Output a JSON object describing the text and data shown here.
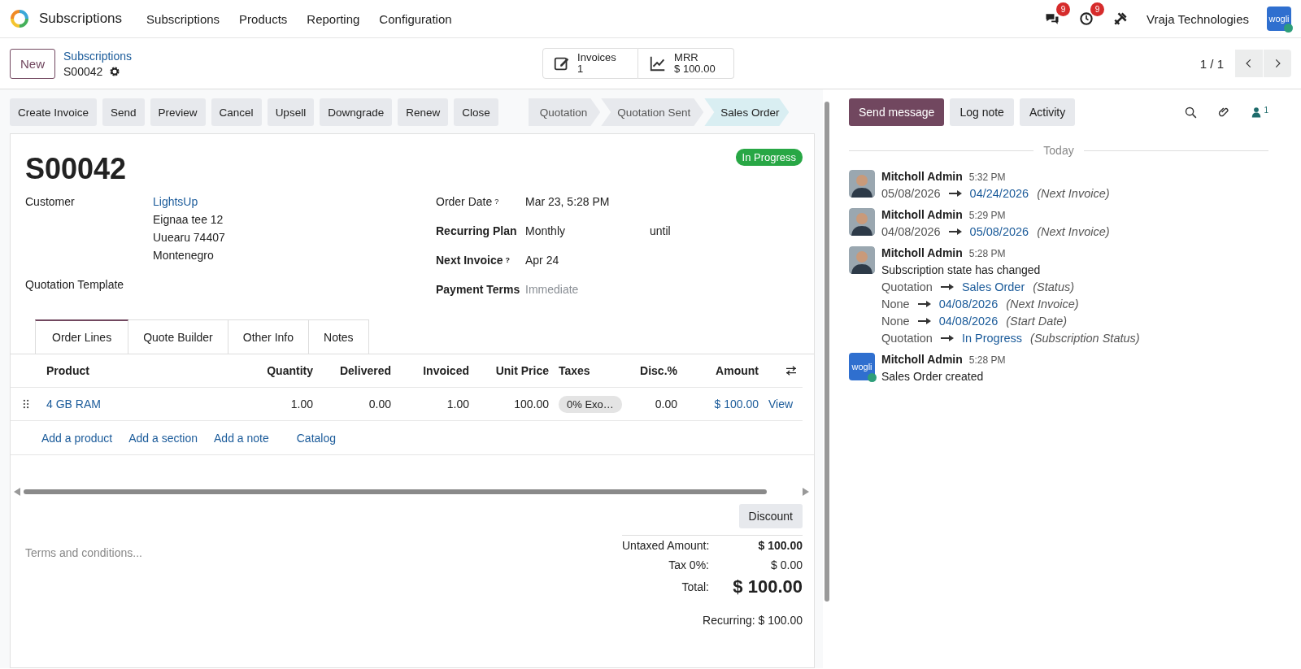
{
  "app": {
    "name": "Subscriptions"
  },
  "menu": [
    "Subscriptions",
    "Products",
    "Reporting",
    "Configuration"
  ],
  "systray": {
    "messages_count": "9",
    "activities_count": "9",
    "company": "Vraja Technologies",
    "company_logo": "wogli"
  },
  "breadcrumb": {
    "parent": "Subscriptions",
    "current": "S00042"
  },
  "new_button": "New",
  "stat_buttons": [
    {
      "kind": "invoices",
      "label": "Invoices",
      "value": "1"
    },
    {
      "kind": "mrr",
      "label": "MRR",
      "value": "$ 100.00"
    }
  ],
  "pager": "1 / 1",
  "actions": [
    "Create Invoice",
    "Send",
    "Preview",
    "Cancel",
    "Upsell",
    "Downgrade",
    "Renew",
    "Close"
  ],
  "statusbar": [
    {
      "label": "Quotation",
      "selected": false
    },
    {
      "label": "Quotation Sent",
      "selected": false
    },
    {
      "label": "Sales Order",
      "selected": true
    }
  ],
  "record": {
    "name": "S00042",
    "status": "In Progress",
    "left_fields": [
      {
        "label": "Customer",
        "bold": false,
        "link": "LightsUp",
        "lines": [
          "Eignaa tee 12",
          "Uuearu 74407",
          "Montenegro"
        ]
      },
      {
        "label": "Quotation Template",
        "bold": false
      }
    ],
    "right_fields": [
      {
        "label": "Order Date",
        "bold": false,
        "help": "?",
        "value": "Mar 23, 5:28 PM"
      },
      {
        "label": "Recurring Plan",
        "bold": true,
        "value": "Monthly",
        "suffix": "until"
      },
      {
        "label": "Next Invoice",
        "bold": true,
        "help": "?",
        "value": "Apr 24"
      },
      {
        "label": "Payment Terms",
        "bold": true,
        "placeholder": "Immediate"
      }
    ]
  },
  "tabs": [
    {
      "label": "Order Lines",
      "selected": true
    },
    {
      "label": "Quote Builder",
      "selected": false
    },
    {
      "label": "Other Info",
      "selected": false
    },
    {
      "label": "Notes",
      "selected": false
    }
  ],
  "table": {
    "columns": [
      "Product",
      "Quantity",
      "Delivered",
      "Invoiced",
      "Unit Price",
      "Taxes",
      "Disc.%",
      "Amount"
    ],
    "rows": [
      {
        "product": "4 GB RAM",
        "quantity": "1.00",
        "delivered": "0.00",
        "invoiced": "1.00",
        "unit_price": "100.00",
        "taxes": "0% Exo…",
        "discount": "0.00",
        "amount": "$ 100.00",
        "action": "View"
      }
    ],
    "add_links": [
      "Add a product",
      "Add a section",
      "Add a note",
      "Catalog"
    ]
  },
  "discount_button": "Discount",
  "terms": {
    "placeholder": "Terms and conditions..."
  },
  "totals": [
    {
      "label": "Untaxed Amount:",
      "value": "$ 100.00",
      "kind": "bold"
    },
    {
      "label": "Tax 0%:",
      "value": "$ 0.00",
      "kind": "normal"
    },
    {
      "label": "Total:",
      "value": "$ 100.00",
      "kind": "total"
    }
  ],
  "recurring": "Recurring: $ 100.00",
  "chatter": {
    "buttons": [
      {
        "label": "Send message",
        "kind": "primary"
      },
      {
        "label": "Log note",
        "kind": "secondary"
      },
      {
        "label": "Activity",
        "kind": "secondary"
      }
    ],
    "followers_count": "1",
    "date_separator": "Today",
    "messages": [
      {
        "author": "Mitcholl Admin",
        "time": "5:32 PM",
        "changes": [
          {
            "old": "05/08/2026",
            "new": "04/24/2026",
            "field": "(Next Invoice)"
          }
        ]
      },
      {
        "author": "Mitcholl Admin",
        "time": "5:29 PM",
        "changes": [
          {
            "old": "04/08/2026",
            "new": "05/08/2026",
            "field": "(Next Invoice)"
          }
        ]
      },
      {
        "author": "Mitcholl Admin",
        "time": "5:28 PM",
        "body": "Subscription state has changed",
        "changes": [
          {
            "old": "Quotation",
            "new": "Sales Order",
            "field": "(Status)"
          },
          {
            "old": "None",
            "new": "04/08/2026",
            "field": "(Next Invoice)"
          },
          {
            "old": "None",
            "new": "04/08/2026",
            "field": "(Start Date)"
          },
          {
            "old": "Quotation",
            "new": "In Progress",
            "field": "(Subscription Status)"
          }
        ]
      },
      {
        "author": "Mitcholl Admin",
        "time": "5:28 PM",
        "avatar_logo": "wogli",
        "body": "Sales Order created"
      }
    ]
  }
}
